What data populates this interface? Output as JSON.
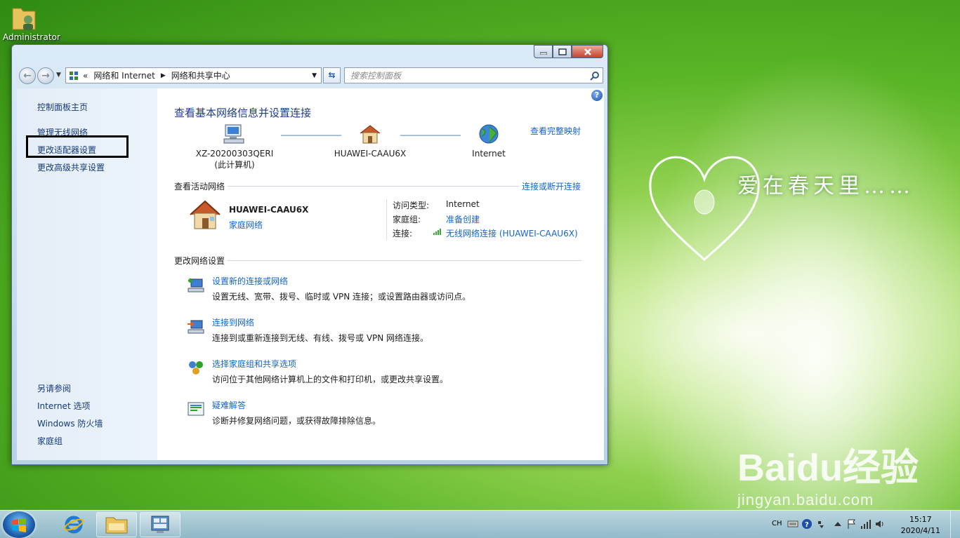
{
  "desktop": {
    "icon_label": "Administrator",
    "slogan": "爱在春天里……",
    "watermark_brand": "Baidu经验",
    "watermark_url": "jingyan.baidu.com"
  },
  "window": {
    "address": {
      "overflow": "«",
      "crumb1": "网络和 Internet",
      "crumb2": "网络和共享中心"
    },
    "search_placeholder": "搜索控制面板",
    "sidebar": {
      "home": "控制面板主页",
      "manage_wireless": "管理无线网络",
      "change_adapter": "更改适配器设置",
      "change_advanced": "更改高级共享设置",
      "see_also": "另请参阅",
      "internet_options": "Internet 选项",
      "firewall": "Windows 防火墙",
      "homegroup": "家庭组"
    },
    "main": {
      "title": "查看基本网络信息并设置连接",
      "view_full_map": "查看完整映射",
      "map_nodes": [
        {
          "label": "XZ-20200303QERI",
          "sublabel": "(此计算机)"
        },
        {
          "label": "HUAWEI-CAAU6X",
          "sublabel": ""
        },
        {
          "label": "Internet",
          "sublabel": ""
        }
      ],
      "active_header": "查看活动网络",
      "connect_disconnect": "连接或断开连接",
      "active_network": {
        "name": "HUAWEI-CAAU6X",
        "type_link": "家庭网络",
        "access_type_label": "访问类型:",
        "access_type_value": "Internet",
        "homegroup_label": "家庭组:",
        "homegroup_value": "准备创建",
        "connection_label": "连接:",
        "connection_value": "无线网络连接 (HUAWEI-CAAU6X)"
      },
      "change_header": "更改网络设置",
      "tasks": [
        {
          "title": "设置新的连接或网络",
          "desc": "设置无线、宽带、拨号、临时或 VPN 连接；或设置路由器或访问点。"
        },
        {
          "title": "连接到网络",
          "desc": "连接到或重新连接到无线、有线、拨号或 VPN 网络连接。"
        },
        {
          "title": "选择家庭组和共享选项",
          "desc": "访问位于其他网络计算机上的文件和打印机，或更改共享设置。"
        },
        {
          "title": "疑难解答",
          "desc": "诊断并修复网络问题，或获得故障排除信息。"
        }
      ]
    }
  },
  "taskbar": {
    "lang": "CH",
    "time": "15:17",
    "date": "2020/4/11"
  },
  "colors": {
    "link": "#1565c8",
    "title": "#1f3c88",
    "highlight_box": "#000000"
  }
}
